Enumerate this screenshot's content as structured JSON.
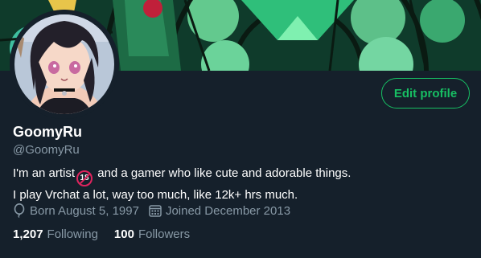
{
  "profile": {
    "display_name": "GoomyRu",
    "handle": "@GoomyRu",
    "bio_line1_before": "I'm an artist",
    "bio_badge": "18",
    "bio_line1_after": " and a gamer who like cute and adorable things.",
    "bio_line2": "I play Vrchat a lot, way too much, like 12k+ hrs much.",
    "birth": "Born August 5, 1997",
    "joined": "Joined December 2013",
    "following_count": "1,207",
    "following_label": "Following",
    "followers_count": "100",
    "followers_label": "Followers"
  },
  "actions": {
    "edit_profile_label": "Edit profile"
  },
  "icons": {
    "birth": "balloon-icon",
    "joined": "calendar-icon",
    "badge": "18-plus-badge-icon"
  },
  "colors": {
    "background": "#15202b",
    "accent": "#17bf63",
    "muted_text": "#8899a6",
    "badge_red": "#e0245e"
  }
}
